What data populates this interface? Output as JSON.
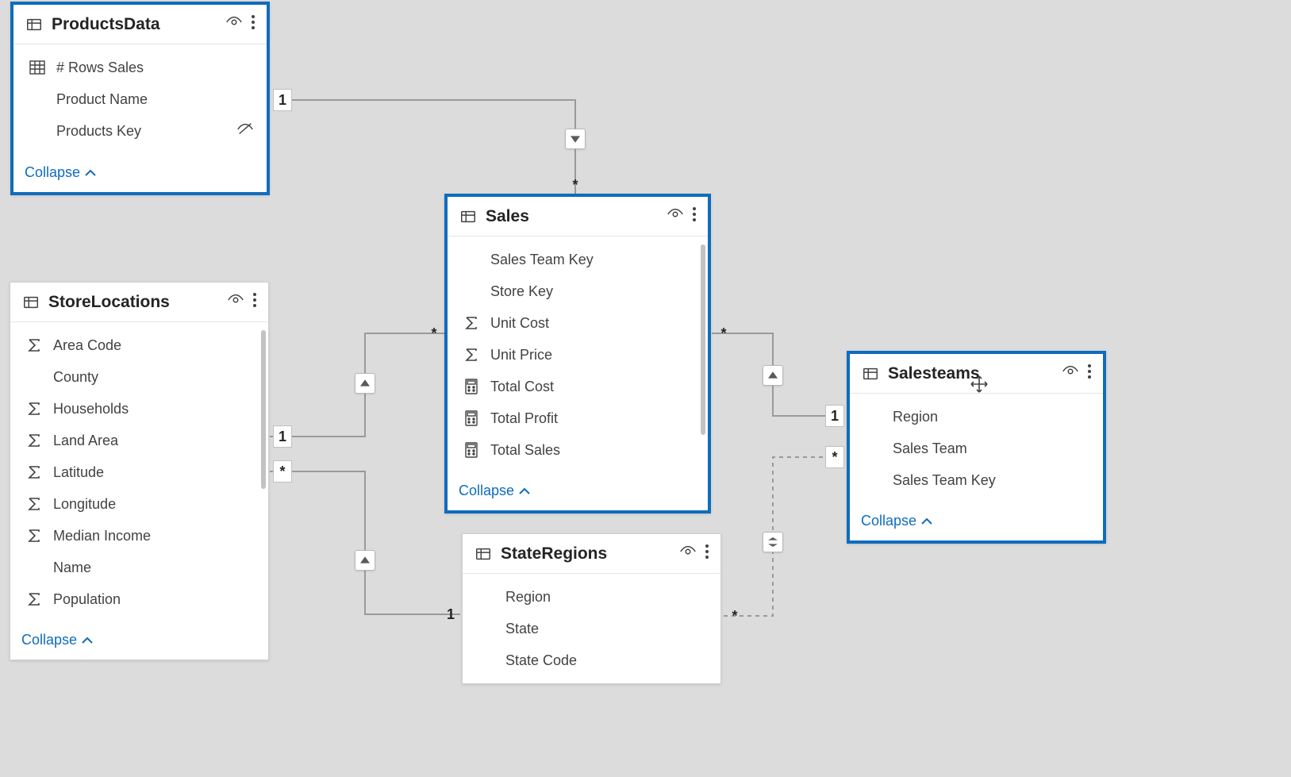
{
  "collapse_label": "Collapse",
  "tables": {
    "productsData": {
      "title": "ProductsData",
      "fields": [
        {
          "icon": "measure-table",
          "name": "# Rows Sales",
          "trailing": null
        },
        {
          "icon": null,
          "name": "Product Name",
          "trailing": null
        },
        {
          "icon": null,
          "name": "Products Key",
          "trailing": "hidden"
        }
      ]
    },
    "sales": {
      "title": "Sales",
      "fields": [
        {
          "icon": null,
          "name": "Sales Team Key",
          "trailing": null
        },
        {
          "icon": null,
          "name": "Store Key",
          "trailing": null
        },
        {
          "icon": "sigma",
          "name": "Unit Cost",
          "trailing": null
        },
        {
          "icon": "sigma",
          "name": "Unit Price",
          "trailing": null
        },
        {
          "icon": "calc",
          "name": "Total Cost",
          "trailing": null
        },
        {
          "icon": "calc",
          "name": "Total Profit",
          "trailing": null
        },
        {
          "icon": "calc",
          "name": "Total Sales",
          "trailing": null
        }
      ]
    },
    "storeLocations": {
      "title": "StoreLocations",
      "fields": [
        {
          "icon": "sigma",
          "name": "Area Code"
        },
        {
          "icon": null,
          "name": "County"
        },
        {
          "icon": "sigma",
          "name": "Households"
        },
        {
          "icon": "sigma",
          "name": "Land Area"
        },
        {
          "icon": "sigma",
          "name": "Latitude"
        },
        {
          "icon": "sigma",
          "name": "Longitude"
        },
        {
          "icon": "sigma",
          "name": "Median Income"
        },
        {
          "icon": null,
          "name": "Name"
        },
        {
          "icon": "sigma",
          "name": "Population"
        }
      ]
    },
    "stateRegions": {
      "title": "StateRegions",
      "fields": [
        {
          "icon": null,
          "name": "Region"
        },
        {
          "icon": null,
          "name": "State"
        },
        {
          "icon": null,
          "name": "State Code"
        }
      ]
    },
    "salesteams": {
      "title": "Salesteams",
      "fields": [
        {
          "icon": null,
          "name": "Region"
        },
        {
          "icon": null,
          "name": "Sales Team"
        },
        {
          "icon": null,
          "name": "Sales Team Key"
        }
      ]
    }
  },
  "relationships": {
    "prod_sales": {
      "from": "1",
      "to": "*"
    },
    "store_sales": {
      "from": "1",
      "to": "*"
    },
    "store_state": {
      "from": "*",
      "to": "1"
    },
    "sales_salesteam": {
      "from": "*",
      "to": "1"
    },
    "state_salesteam": {
      "from": "*",
      "to": "*"
    }
  }
}
